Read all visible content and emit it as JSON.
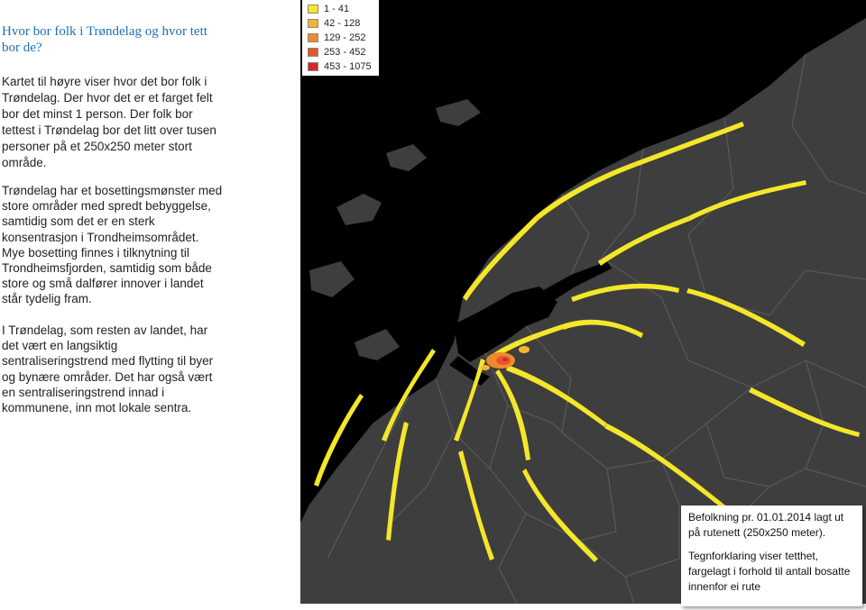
{
  "title": "Hvor bor folk i Trøndelag og hvor tett bor de?",
  "intro": "Kartet til høyre viser hvor det bor folk i Trøndelag. Der hvor det er et farget felt bor det minst 1 person. Der folk bor tettest i Trøndelag bor det litt over tusen personer på et 250x250 meter stort område.",
  "paragraph_1": "Trøndelag har et bosettingsmønster med store områder med spredt bebyggelse, samtidig som det er en sterk konsentrasjon i Trondheimsområdet. Mye bosetting finnes i tilknytning til Trondheimsfjorden, samtidig som både store og små dalfører innover i landet står tydelig fram.",
  "paragraph_2": "I Trøndelag, som resten av landet, har det vært en langsiktig sentraliseringstrend med flytting til byer og bynære områder. Det har også vært en sentraliseringstrend innad i kommunene, inn mot lokale sentra.",
  "legend": {
    "items": [
      {
        "label": "1 - 41",
        "color": "#f4e62a"
      },
      {
        "label": "42 - 128",
        "color": "#f2b531"
      },
      {
        "label": "129 - 252",
        "color": "#ef8a2c"
      },
      {
        "label": "253 - 452",
        "color": "#e4562a"
      },
      {
        "label": "453 - 1075",
        "color": "#d8262b"
      }
    ]
  },
  "infobox": {
    "line1": "Befolkning pr. 01.01.2014 lagt ut på rutenett (250x250 meter).",
    "line2": "Tegnforklaring viser tetthet, fargelagt i forhold til antall bosatte innenfor ei rute"
  },
  "map_colors": {
    "sea": "#000000",
    "land": "#3e3e3e",
    "border": "#5e5e5e"
  }
}
